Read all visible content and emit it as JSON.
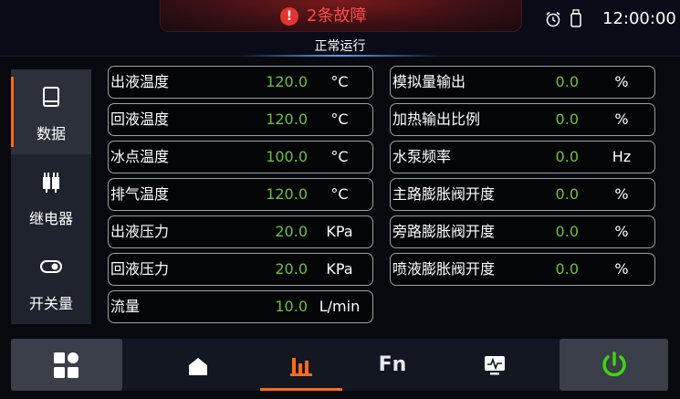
{
  "header": {
    "alarm_icon_glyph": "!",
    "alarm_text": "2条故障",
    "status_text": "正常运行",
    "time": "12:00:00",
    "icons": [
      "alarm-clock-icon",
      "usb-drive-icon"
    ]
  },
  "sidebar": {
    "items": [
      {
        "label": "数据",
        "icon": "book-icon",
        "active": true
      },
      {
        "label": "继电器",
        "icon": "relay-icon",
        "active": false
      },
      {
        "label": "开关量",
        "icon": "toggle-icon",
        "active": false
      }
    ]
  },
  "left_rows": [
    {
      "name": "出液温度",
      "value": "120.0",
      "unit": "°C"
    },
    {
      "name": "回液温度",
      "value": "120.0",
      "unit": "°C"
    },
    {
      "name": "冰点温度",
      "value": "100.0",
      "unit": "°C"
    },
    {
      "name": "排气温度",
      "value": "120.0",
      "unit": "°C"
    },
    {
      "name": "出液压力",
      "value": "20.0",
      "unit": "KPa"
    },
    {
      "name": "回液压力",
      "value": "20.0",
      "unit": "KPa"
    },
    {
      "name": "流量",
      "value": "10.0",
      "unit": "L/min"
    }
  ],
  "right_rows": [
    {
      "name": "模拟量输出",
      "value": "0.0",
      "unit": "%"
    },
    {
      "name": "加热输出比例",
      "value": "0.0",
      "unit": "%"
    },
    {
      "name": "水泵频率",
      "value": "0.0",
      "unit": "Hz"
    },
    {
      "name": "主路膨胀阀开度",
      "value": "0.0",
      "unit": "%"
    },
    {
      "name": "旁路膨胀阀开度",
      "value": "0.0",
      "unit": "%"
    },
    {
      "name": "喷液膨胀阀开度",
      "value": "0.0",
      "unit": "%"
    }
  ],
  "bottom_nav": {
    "menu_icon": "grid-menu-icon",
    "tabs": [
      {
        "icon": "home-icon",
        "label": ""
      },
      {
        "icon": "bar-chart-icon",
        "label": "",
        "active": true
      },
      {
        "icon": "fn-icon",
        "label": "Fn"
      },
      {
        "icon": "monitor-icon",
        "label": ""
      }
    ],
    "power_icon": "power-icon"
  },
  "colors": {
    "accent": "#ff6a1a",
    "value": "#6ec23a",
    "alarm": "#ff4a4a",
    "power": "#3fd60e"
  }
}
